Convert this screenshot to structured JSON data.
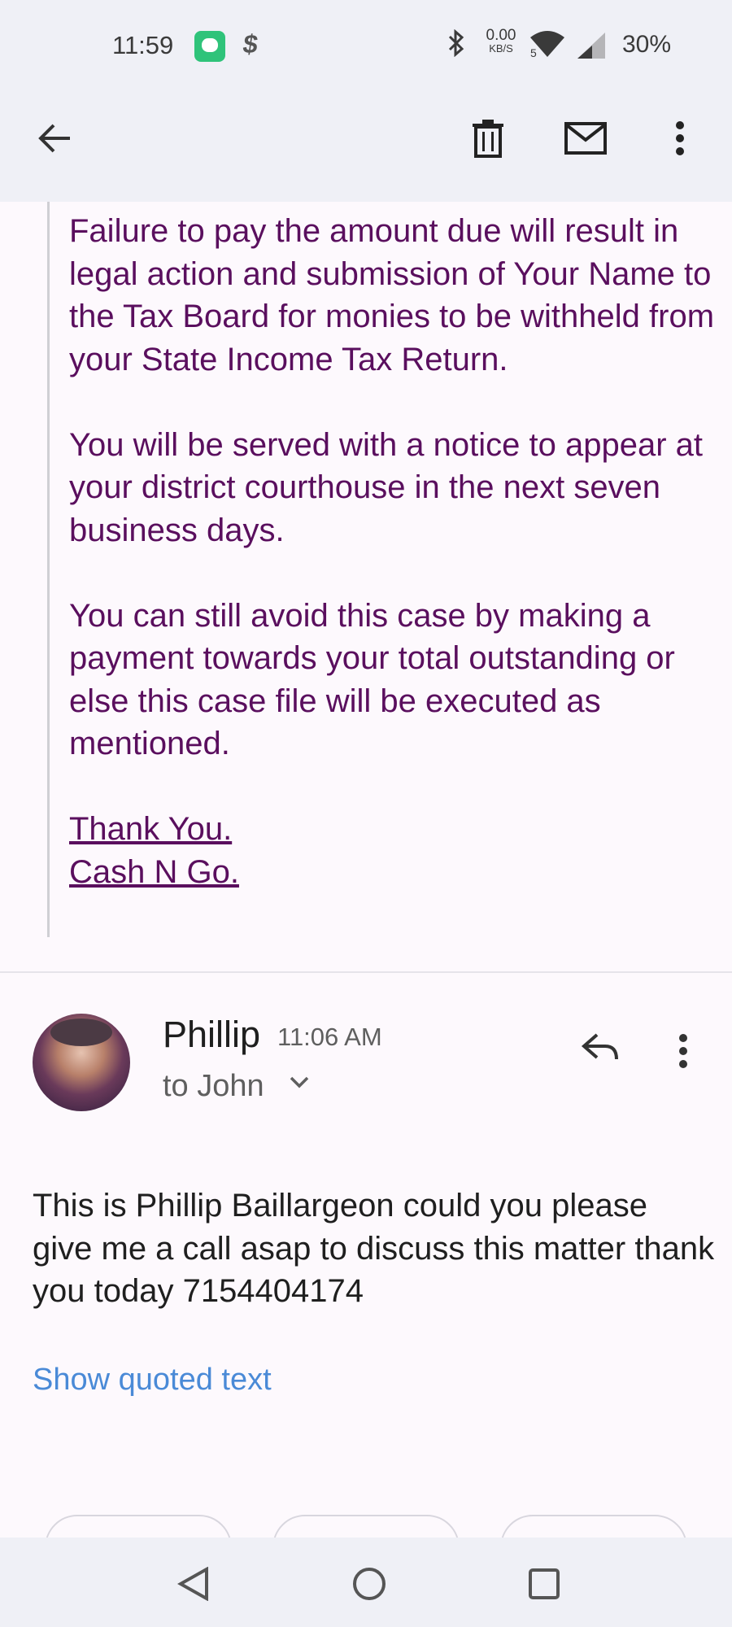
{
  "status_bar": {
    "time": "11:59",
    "net_speed_value": "0.00",
    "net_speed_unit": "KB/S",
    "battery": "30%"
  },
  "app_bar": {
    "back_label": "",
    "delete_label": "",
    "mark_unread_label": "",
    "more_label": ""
  },
  "quoted_message": {
    "paragraphs": [
      "Failure to pay the amount due will result in legal action and submission of Your Name to the Tax Board for monies to be withheld from your State Income Tax Return.",
      "You will be served with a notice to appear at your district courthouse in the next seven business days.",
      "You can still avoid this case by making a payment towards your total outstanding or else this case file will be executed as mentioned."
    ],
    "closing": "Thank You.",
    "signature": "Cash N Go."
  },
  "message": {
    "sender": "Phillip",
    "time": "11:06 AM",
    "recipient": "to John",
    "body": "This is Phillip Baillargeon could you please give me a call asap to discuss this matter thank you today 7154404174",
    "show_quoted": "Show quoted text"
  },
  "colors": {
    "quoted_text": "#5a0f5e",
    "link_blue": "#4a8ad7",
    "bar_bg": "#eff0f6",
    "page_bg": "#fdf9fd"
  },
  "icons": {
    "status": [
      "messages-app-icon",
      "cash-app-icon",
      "bluetooth-icon",
      "wifi-icon",
      "cell-signal-icon"
    ],
    "app_bar": [
      "back-arrow-icon",
      "trash-icon",
      "mail-icon",
      "more-vert-icon"
    ],
    "message": [
      "reply-icon",
      "more-vert-icon",
      "chevron-down-icon"
    ],
    "nav": [
      "back-triangle-icon",
      "home-circle-icon",
      "recents-square-icon"
    ]
  }
}
